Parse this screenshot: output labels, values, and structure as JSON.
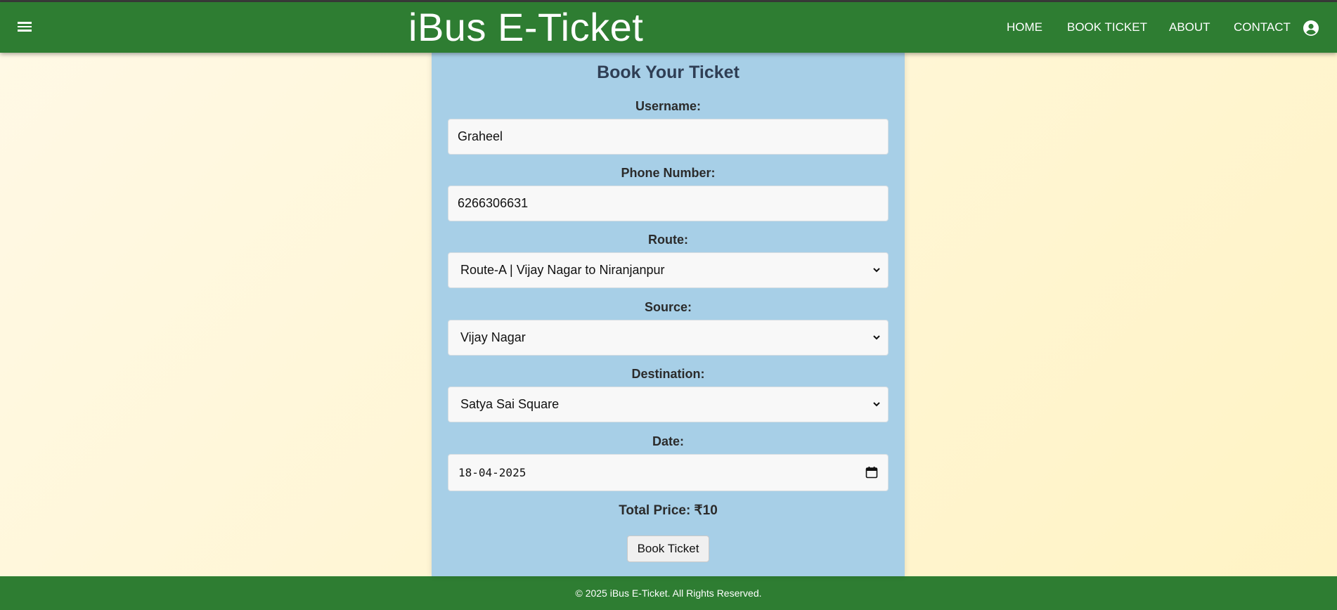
{
  "header": {
    "title": "iBus E-Ticket",
    "nav": [
      "HOME",
      "BOOK TICKET",
      "ABOUT",
      "CONTACT"
    ],
    "menu_icon": "hamburger-menu-icon",
    "account_icon": "account-circle-icon"
  },
  "form": {
    "title": "Book Your Ticket",
    "username_label": "Username:",
    "username_value": "Graheel",
    "phone_label": "Phone Number:",
    "phone_value": "6266306631",
    "route_label": "Route:",
    "route_value": "Route-A | Vijay Nagar to Niranjanpur",
    "source_label": "Source:",
    "source_value": "Vijay Nagar",
    "destination_label": "Destination:",
    "destination_value": "Satya Sai Square",
    "date_label": "Date:",
    "date_value": "18-04-2025",
    "total_price": "Total Price: ₹10",
    "submit_label": "Book Ticket"
  },
  "footer": {
    "text": "© 2025 iBus E-Ticket. All Rights Reserved."
  },
  "colors": {
    "header_bg": "#2e7d32",
    "card_bg": "#a7cfe7",
    "page_bg": "#fff6d6",
    "title_text": "#2f3e54"
  }
}
